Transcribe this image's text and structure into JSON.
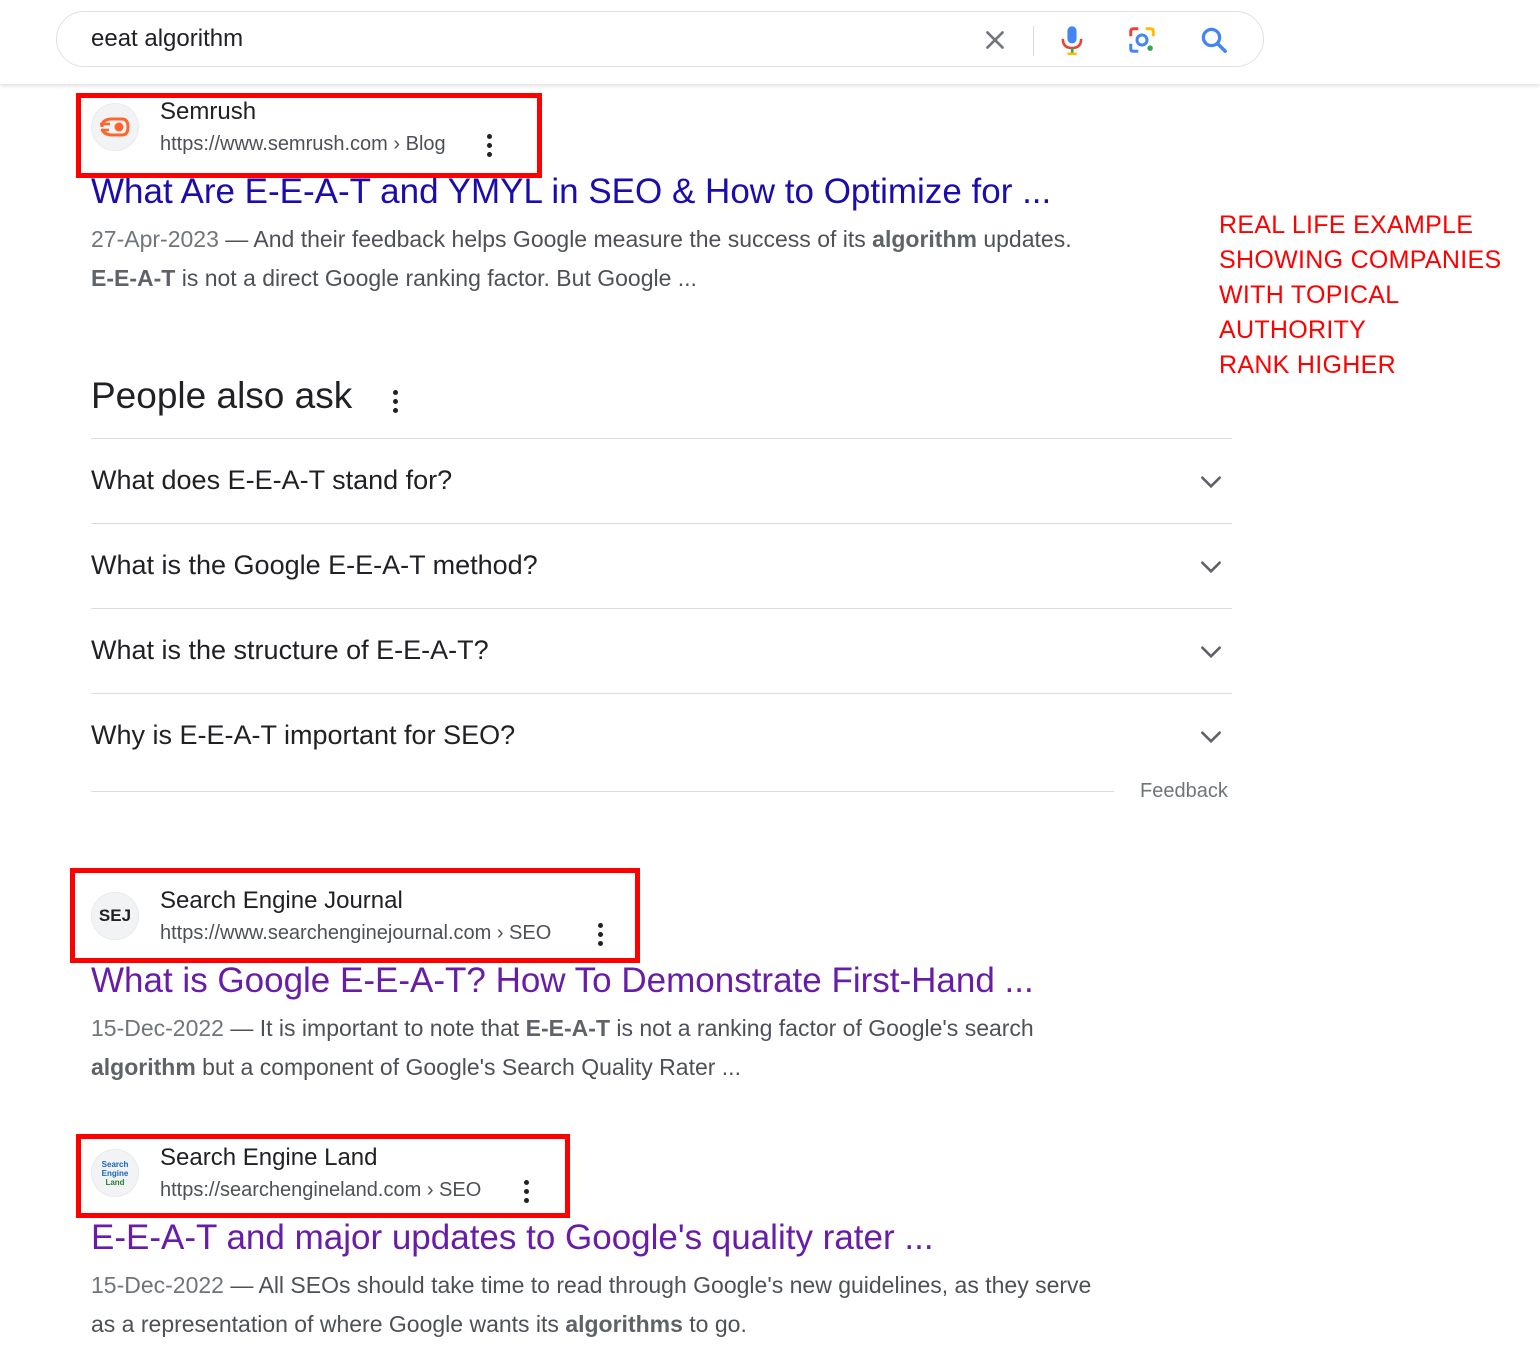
{
  "search": {
    "query": "eeat algorithm",
    "icons": [
      "close-icon",
      "mic-icon",
      "lens-icon",
      "search-icon"
    ]
  },
  "results": [
    {
      "site_name": "Semrush",
      "url": "https://www.semrush.com › Blog",
      "title": "What Are E-E-A-T and YMYL in SEO & How to Optimize for ...",
      "date": "27-Apr-2023",
      "dash": " — ",
      "snippet": [
        {
          "text": "And their feedback helps Google measure the success of its ",
          "bold": false
        },
        {
          "text": "algorithm",
          "bold": true
        },
        {
          "text": " updates. ",
          "bold": false
        },
        {
          "text": "E-E-A-T",
          "bold": true
        },
        {
          "text": " is not a direct Google ranking factor. But Google ...",
          "bold": false
        }
      ],
      "favicon": "semrush-logo-icon"
    },
    {
      "site_name": "Search Engine Journal",
      "url": "https://www.searchenginejournal.com › SEO",
      "title": "What is Google E-E-A-T? How To Demonstrate First-Hand ...",
      "date": "15-Dec-2022",
      "dash": " — ",
      "snippet": [
        {
          "text": "It is important to note that ",
          "bold": false
        },
        {
          "text": "E-E-A-T",
          "bold": true
        },
        {
          "text": " is not a ranking factor of Google's search ",
          "bold": false
        },
        {
          "text": "algorithm",
          "bold": true
        },
        {
          "text": " but a component of Google's Search Quality Rater ...",
          "bold": false
        }
      ],
      "favicon_text": "SEJ"
    },
    {
      "site_name": "Search Engine Land",
      "url": "https://searchengineland.com › SEO",
      "title": "E-E-A-T and major updates to Google's quality rater ...",
      "date": "15-Dec-2022",
      "dash": " — ",
      "snippet": [
        {
          "text": "All SEOs should take time to read through Google's new guidelines, as they serve as a representation of where Google wants its ",
          "bold": false
        },
        {
          "text": "algorithms",
          "bold": true
        },
        {
          "text": " to go.",
          "bold": false
        }
      ],
      "favicon_lines": [
        "Search",
        "Engine",
        "Land"
      ]
    }
  ],
  "people_also_ask": {
    "title": "People also ask",
    "questions": [
      "What does E-E-A-T stand for?",
      "What is the Google E-E-A-T method?",
      "What is the structure of E-E-A-T?",
      "Why is E-E-A-T important for SEO?"
    ],
    "feedback": "Feedback"
  },
  "annotation": {
    "lines": [
      "REAL LIFE EXAMPLE",
      "SHOWING COMPANIES",
      "WITH TOPICAL AUTHORITY",
      "RANK HIGHER"
    ],
    "color": "#ff0000"
  },
  "colors": {
    "link": "#1a0dab",
    "visited": "#681da8",
    "highlight_box": "#ff0000"
  }
}
